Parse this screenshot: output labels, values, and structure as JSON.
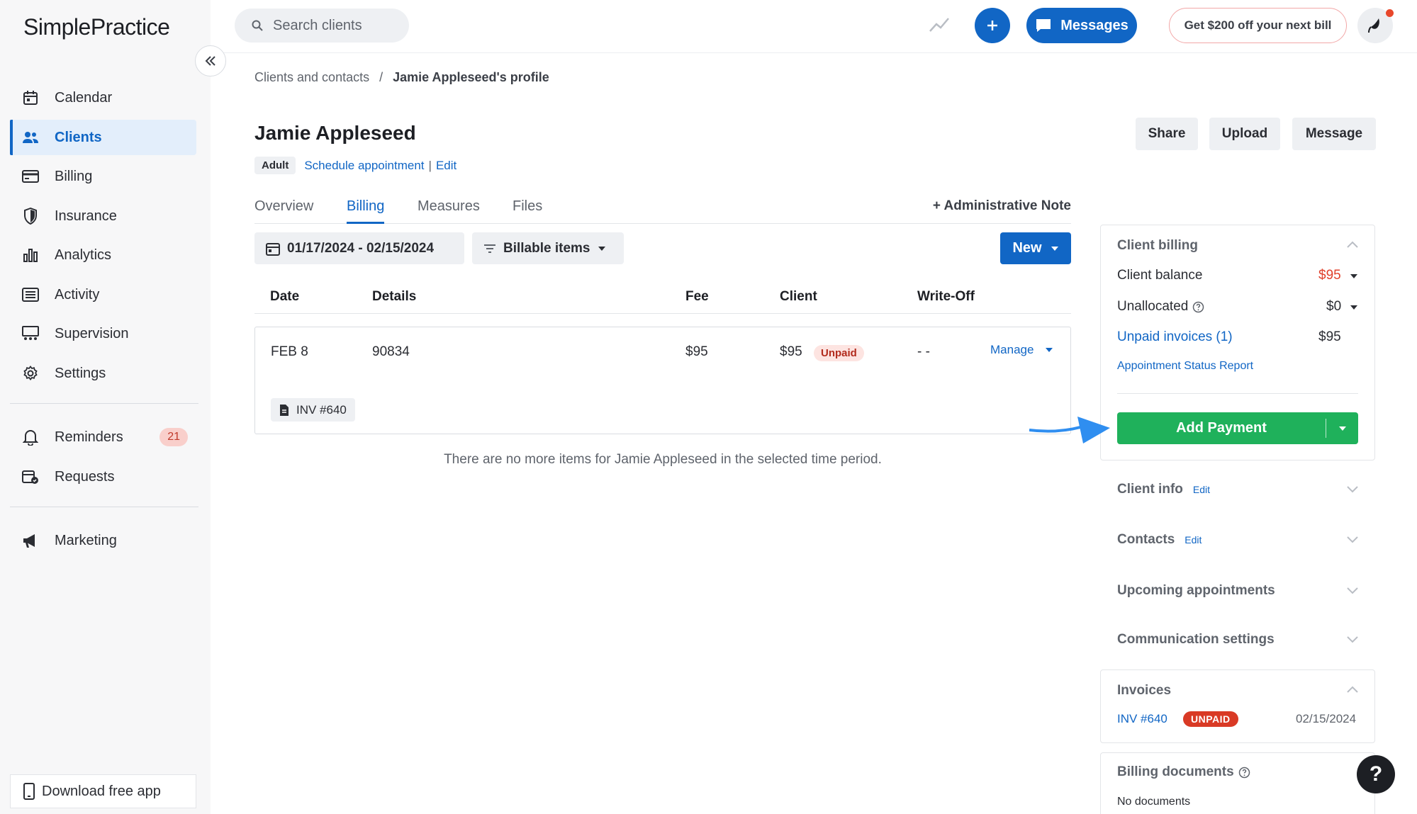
{
  "app": {
    "logo_text": "SimplePractice"
  },
  "sidebar": {
    "items": [
      {
        "label": "Calendar",
        "icon": "calendar-icon"
      },
      {
        "label": "Clients",
        "icon": "clients-icon",
        "active": true
      },
      {
        "label": "Billing",
        "icon": "credit-card-icon"
      },
      {
        "label": "Insurance",
        "icon": "shield-icon"
      },
      {
        "label": "Analytics",
        "icon": "bar-chart-icon"
      },
      {
        "label": "Activity",
        "icon": "list-icon"
      },
      {
        "label": "Supervision",
        "icon": "supervision-icon"
      },
      {
        "label": "Settings",
        "icon": "gear-icon"
      },
      {
        "label": "Reminders",
        "icon": "bell-icon",
        "badge": "21"
      },
      {
        "label": "Requests",
        "icon": "calendar-request-icon"
      },
      {
        "label": "Marketing",
        "icon": "megaphone-icon"
      }
    ],
    "download_app": "Download free app"
  },
  "topbar": {
    "search_placeholder": "Search clients",
    "messages_label": "Messages",
    "promo_label": "Get $200 off your next bill"
  },
  "breadcrumb": {
    "parent": "Clients and contacts",
    "separator": "/",
    "current": "Jamie Appleseed's profile"
  },
  "client": {
    "name": "Jamie Appleseed",
    "tag": "Adult",
    "schedule_link": "Schedule appointment",
    "separator": "|",
    "edit_link": "Edit"
  },
  "actions": {
    "share": "Share",
    "upload": "Upload",
    "message": "Message"
  },
  "tabs": [
    "Overview",
    "Billing",
    "Measures",
    "Files"
  ],
  "active_tab": "Billing",
  "admin_note": "+ Administrative Note",
  "filters": {
    "date_range": "01/17/2024 - 02/15/2024",
    "billable_items": "Billable items",
    "new_label": "New"
  },
  "table": {
    "headers": [
      "Date",
      "Details",
      "Fee",
      "Client",
      "Write-Off"
    ],
    "rows": [
      {
        "date": "FEB 8",
        "details": "90834",
        "fee": "$95",
        "client": "$95",
        "status": "Unpaid",
        "write_off": "- -",
        "manage": "Manage",
        "invoice": "INV #640"
      }
    ],
    "empty_message": "There are no more items for Jamie Appleseed in the selected time period."
  },
  "client_billing": {
    "title": "Client billing",
    "balance_label": "Client balance",
    "balance_value": "$95",
    "unallocated_label": "Unallocated",
    "unallocated_value": "$0",
    "unpaid_invoices_label": "Unpaid invoices (1)",
    "unpaid_invoices_value": "$95",
    "status_report_link": "Appointment Status Report",
    "add_payment_label": "Add Payment"
  },
  "sections": {
    "client_info": "Client info",
    "contacts": "Contacts",
    "edit": "Edit",
    "upcoming": "Upcoming appointments",
    "communication": "Communication settings"
  },
  "invoices": {
    "title": "Invoices",
    "items": [
      {
        "number": "INV #640",
        "status": "UNPAID",
        "date": "02/15/2024"
      }
    ]
  },
  "billing_documents": {
    "title": "Billing documents",
    "empty": "No documents"
  },
  "help": {
    "label": "?"
  },
  "colors": {
    "accent": "#1166c5",
    "success": "#1fb15b",
    "danger": "#d93a25",
    "balance": "#e0402b"
  }
}
